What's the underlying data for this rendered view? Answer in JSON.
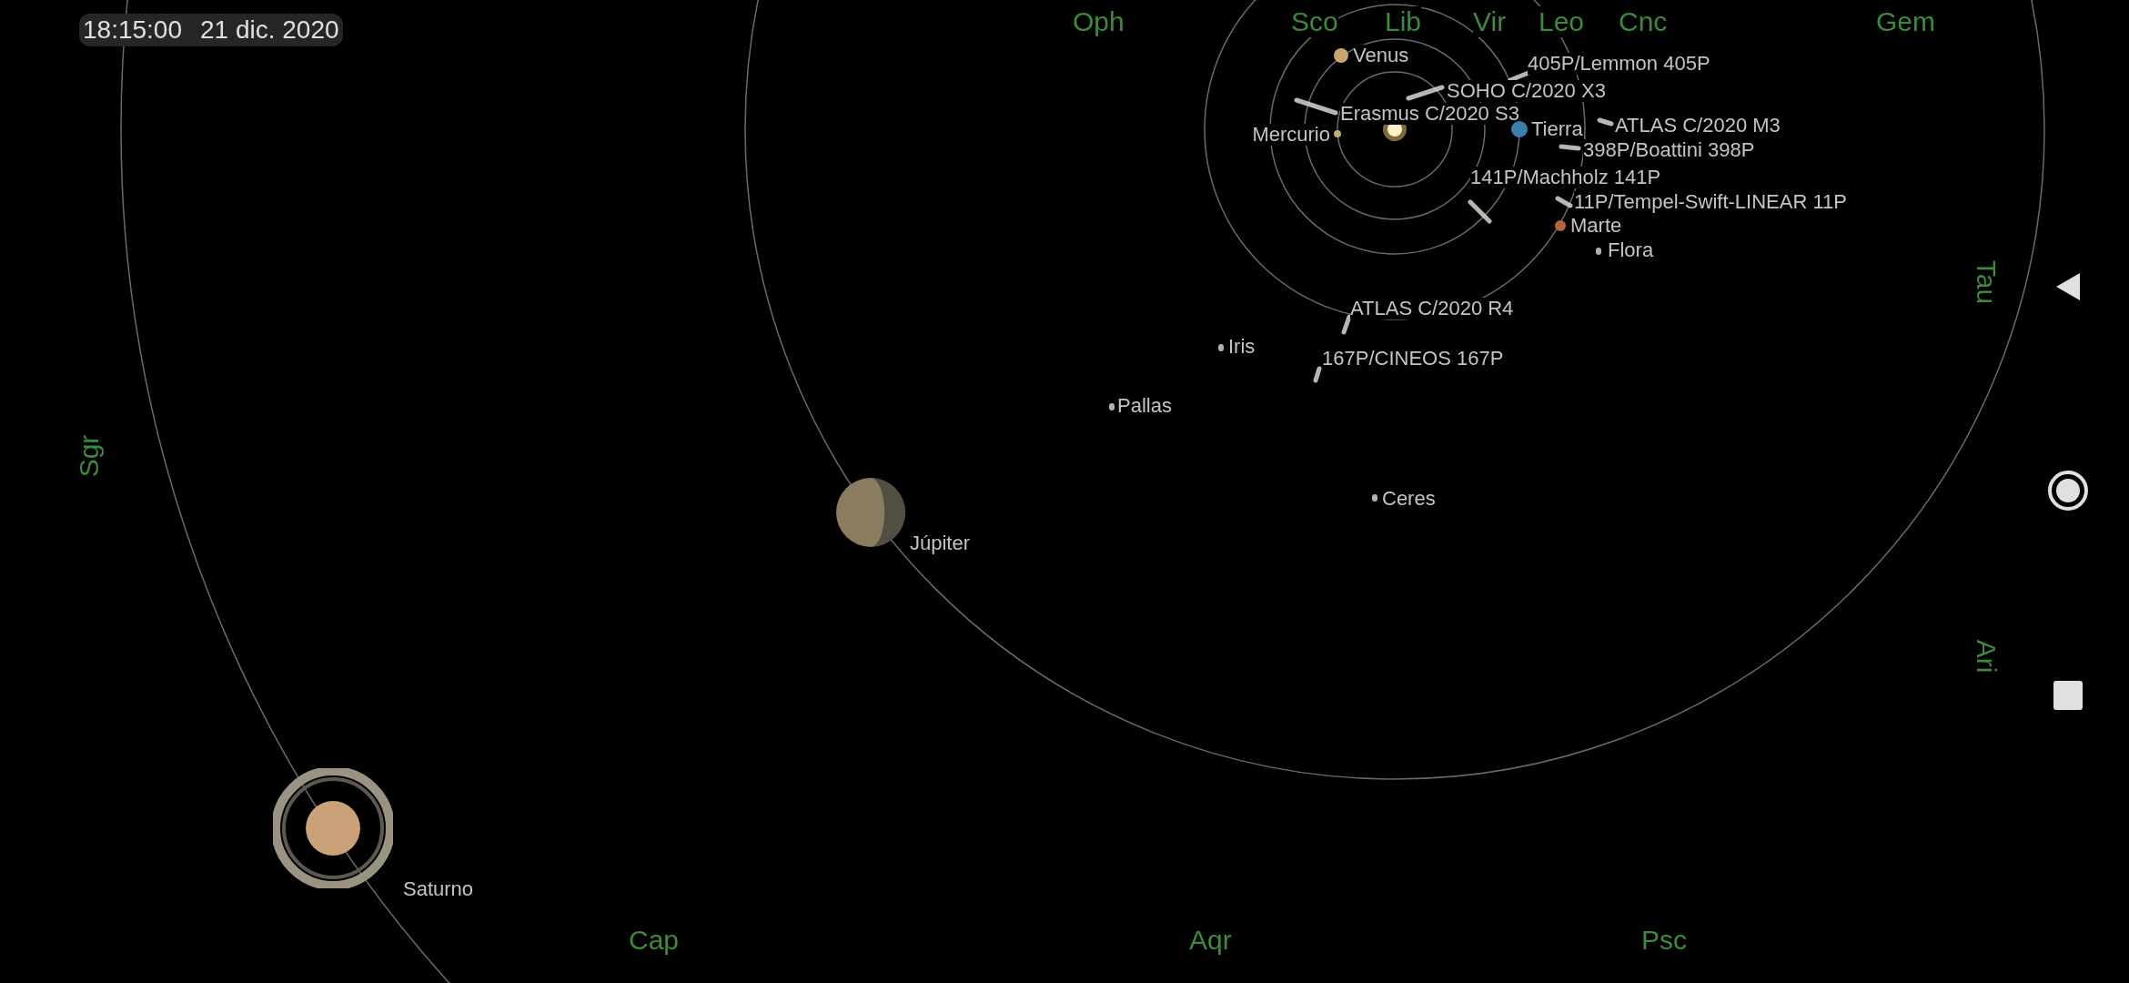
{
  "clock": {
    "time": "18:15:00",
    "date": "21 dic. 2020"
  },
  "constellations": [
    {
      "label": "Oph"
    },
    {
      "label": "Sco"
    },
    {
      "label": "Lib"
    },
    {
      "label": "Vir"
    },
    {
      "label": "Leo"
    },
    {
      "label": "Cnc"
    },
    {
      "label": "Gem"
    },
    {
      "label": "Tau"
    },
    {
      "label": "Sgr"
    },
    {
      "label": "Ari"
    },
    {
      "label": "Cap"
    },
    {
      "label": "Aqr"
    },
    {
      "label": "Psc"
    }
  ],
  "bodies": [
    {
      "kind": "planet",
      "label": "Venus"
    },
    {
      "kind": "comet",
      "label": "405P/Lemmon 405P"
    },
    {
      "kind": "comet",
      "label": "SOHO C/2020 X3"
    },
    {
      "kind": "comet",
      "label": "Erasmus C/2020 S3"
    },
    {
      "kind": "planet",
      "label": "Mercurio"
    },
    {
      "kind": "planet",
      "label": "Tierra"
    },
    {
      "kind": "comet",
      "label": "ATLAS C/2020 M3"
    },
    {
      "kind": "comet",
      "label": "398P/Boattini 398P"
    },
    {
      "kind": "comet",
      "label": "141P/Machholz 141P"
    },
    {
      "kind": "comet",
      "label": "11P/Tempel-Swift-LINEAR 11P"
    },
    {
      "kind": "planet",
      "label": "Marte"
    },
    {
      "kind": "asteroid",
      "label": "Flora"
    },
    {
      "kind": "comet",
      "label": "ATLAS C/2020 R4"
    },
    {
      "kind": "asteroid",
      "label": "Iris"
    },
    {
      "kind": "comet",
      "label": "167P/CINEOS 167P"
    },
    {
      "kind": "asteroid",
      "label": "Pallas"
    },
    {
      "kind": "asteroid",
      "label": "Ceres"
    },
    {
      "kind": "planet",
      "label": "Júpiter"
    },
    {
      "kind": "ringed_planet",
      "label": "Saturno"
    }
  ],
  "nav_bar": [
    {
      "kind": "back"
    },
    {
      "kind": "home"
    },
    {
      "kind": "recents"
    }
  ]
}
